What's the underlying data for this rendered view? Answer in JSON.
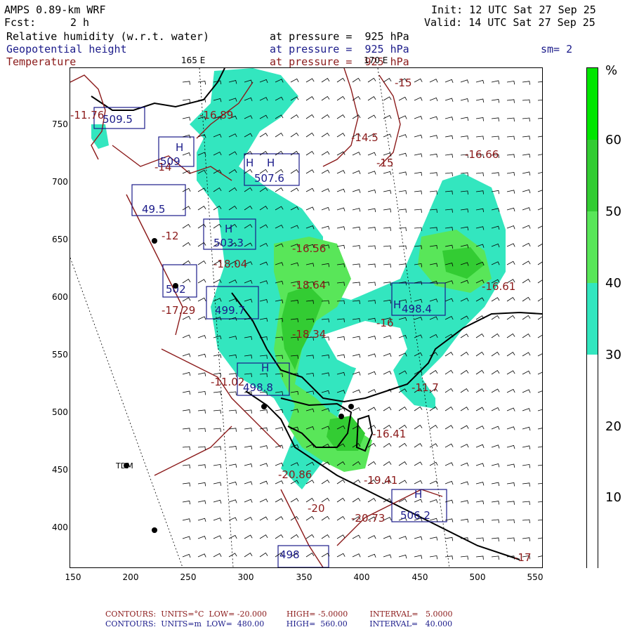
{
  "header": {
    "model": "AMPS 0.89-km WRF",
    "fcst_label": "Fcst:",
    "fcst_value": "2 h",
    "init": "Init: 12 UTC Sat 27 Sep 25",
    "valid": "Valid: 14 UTC Sat 27 Sep 25",
    "field1": "Relative humidity (w.r.t. water)",
    "field2": "Geopotential height",
    "field3": "Temperature",
    "pressure1": "at pressure =  925 hPa",
    "pressure2": "at pressure =  925 hPa",
    "pressure3": "at pressure =  925 hPa",
    "smoothing": "sm= 2",
    "lon_label_1": "165 E",
    "lon_label_2": "170 E"
  },
  "colors": {
    "height_contours": "#1b1b8a",
    "temperature_contours": "#8b1a1a",
    "coast": "#000000",
    "rh_30": "#33e6bf",
    "rh_40": "#59e659",
    "rh_50": "#33cc33",
    "rh_60": "#00e600"
  },
  "colorbar": {
    "unit": "%",
    "ticks": [
      "10",
      "20",
      "30",
      "40",
      "50",
      "60"
    ],
    "bands": [
      {
        "from": 0,
        "to": 30,
        "color": "#ffffff"
      },
      {
        "from": 30,
        "to": 40,
        "color": "#33e6bf"
      },
      {
        "from": 40,
        "to": 50,
        "color": "#59e659"
      },
      {
        "from": 50,
        "to": 60,
        "color": "#33cc33"
      },
      {
        "from": 60,
        "to": 70,
        "color": "#00e600"
      }
    ]
  },
  "axes": {
    "x_ticks": [
      "150",
      "200",
      "250",
      "300",
      "350",
      "400",
      "450",
      "500",
      "550"
    ],
    "y_ticks": [
      "750",
      "700",
      "650",
      "600",
      "550",
      "500",
      "450",
      "400"
    ]
  },
  "stations": [
    {
      "label": "TDM"
    }
  ],
  "temperature_labels": [
    "-11.76",
    "-16.89",
    "-14.5",
    "-15",
    "-15",
    "-16.66",
    "-16.56",
    "-18.64",
    "-16.61",
    "-18.04",
    "-17.29",
    "-16",
    "-18.34",
    "-11.7",
    "-11.02",
    "-16.41",
    "-20.86",
    "-19.41",
    "-20",
    "-20.73",
    "-12",
    "-17",
    "-14"
  ],
  "height_labels": [
    "509.5",
    "509",
    "507.6",
    "49.5",
    "503.3",
    "502",
    "498.4",
    "499.7",
    "498.8",
    "506.2",
    "498"
  ],
  "footer": {
    "temp_contours": "CONTOURS:  UNITS=°C  LOW= -20.000        HIGH= -5.0000         INTERVAL=   5.0000",
    "height_contours": "CONTOURS:  UNITS=m  LOW=  480.00         HIGH=  560.00         INTERVAL=   40.000"
  }
}
